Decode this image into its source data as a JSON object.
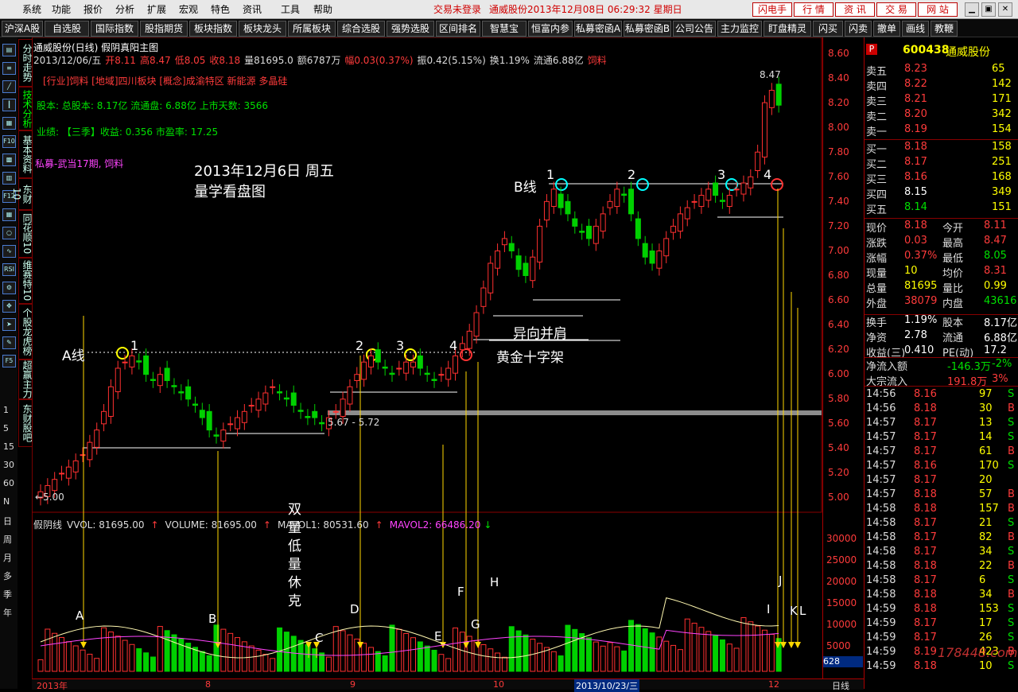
{
  "menu": [
    "系统",
    "功能",
    "报价",
    "分析",
    "扩展",
    "宏观",
    "特色",
    "资讯",
    "工具",
    "帮助"
  ],
  "status": {
    "trade_state": "交易未登录",
    "datetime": "通威股份2013年12月08日  06:29:32  星期日"
  },
  "top_buttons": [
    "闪电手",
    "行 情",
    "资 讯",
    "交 易",
    "网 站"
  ],
  "toolbar": [
    "沪深A股",
    "自选股",
    "国际指数",
    "股指期货",
    "板块指数",
    "板块龙头",
    "所属板块",
    "综合选股",
    "强势选股",
    "区间排名",
    "智慧宝",
    "恒富内参",
    "私募密函A",
    "私募密函B",
    "公司公告",
    "主力监控",
    "盯盘精灵",
    "闪买",
    "闪卖",
    "撤单",
    "画线",
    "教鞭"
  ],
  "left_strip": {
    "icons": [
      "chart-icon",
      "list-icon",
      "line-icon",
      "candle-icon",
      "table-icon",
      "F10",
      "grid-icon",
      "layers-icon",
      "F12",
      "table-icon",
      "search-icon",
      "wave-icon",
      "RSI",
      "gear-icon",
      "move-icon",
      "pointer-icon",
      "pen-icon",
      "F5"
    ],
    "periods": [
      "1",
      "5",
      "15",
      "30",
      "60",
      "N",
      "日",
      "周",
      "月",
      "多",
      "季",
      "年"
    ]
  },
  "vertical_tabs": [
    "分时走势",
    "技术分析",
    "基本资料",
    "东财10",
    "同花顺10",
    "维赛特10",
    "个股龙虎榜",
    "超赢主力",
    "东财股吧"
  ],
  "chart": {
    "title": "通威股份(日线) 假阴真阳主图",
    "ohlc_line": [
      "2013/12/06/五",
      "开8.11",
      "高8.47",
      "低8.05",
      "收8.18",
      "量81695.0",
      "额6787万",
      "幅0.03(0.37%)",
      "振0.42(5.15%)",
      "换1.19%",
      "流通6.88亿",
      "饲料"
    ],
    "industry": "[行业]饲料 [地域]四川板块 [概念]成渝特区 新能源 多晶硅",
    "equity": "股本: 总股本: 8.17亿 流通盘: 6.88亿 上市天数: 3566",
    "earnings": "业绩: 【三季】收益: 0.356 市盈率: 17.25",
    "private_fund": "私募-武当17期, 饲料",
    "heading_1": "2013年12月6日  周五",
    "heading_2": "量学看盘图",
    "low_marker": "←5.00",
    "high_marker": "8.47",
    "range_label": "5.67 - 5.72",
    "a_line": "A线",
    "b_line": "B线",
    "annot_1": "异向并肩",
    "annot_2": "黄金十字架",
    "vertical_note": [
      "双",
      "量",
      "低",
      "量",
      "休",
      "克"
    ],
    "volume_line": {
      "name": "假阴线",
      "vvol": "VVOL: 81695.00",
      "volume": "VOLUME: 81695.00",
      "mavol1": "MAVOL1: 80531.60",
      "mavol2": "MAVOL2: 66486.20"
    },
    "letters": [
      "A",
      "B",
      "C",
      "D",
      "E",
      "F",
      "G",
      "H",
      "I",
      "J",
      "K",
      "L"
    ],
    "numbers": [
      "1",
      "2",
      "3",
      "4"
    ]
  },
  "price_axis": [
    "8.60",
    "8.40",
    "8.20",
    "8.00",
    "7.80",
    "7.60",
    "7.40",
    "7.20",
    "7.00",
    "6.80",
    "6.60",
    "6.40",
    "6.20",
    "6.00",
    "5.80",
    "5.60",
    "5.40",
    "5.20",
    "5.00"
  ],
  "volume_axis": [
    "30000",
    "25000",
    "20000",
    "15000",
    "10000",
    "5000"
  ],
  "volume_axis_value": "628",
  "bottom_dates": [
    "2013年",
    "8",
    "9",
    "10",
    "2013/10/23/三",
    "12"
  ],
  "bottom_period": "日线",
  "quote": {
    "header_tag": "P",
    "code": "600438",
    "name": "通威股份",
    "sell": [
      [
        "卖五",
        "8.23",
        "65"
      ],
      [
        "卖四",
        "8.22",
        "142"
      ],
      [
        "卖三",
        "8.21",
        "171"
      ],
      [
        "卖二",
        "8.20",
        "342"
      ],
      [
        "卖一",
        "8.19",
        "154"
      ]
    ],
    "buy": [
      [
        "买一",
        "8.18",
        "158"
      ],
      [
        "买二",
        "8.17",
        "251"
      ],
      [
        "买三",
        "8.16",
        "168"
      ],
      [
        "买四",
        "8.15",
        "349"
      ],
      [
        "买五",
        "8.14",
        "151"
      ]
    ],
    "stats": [
      [
        "现价",
        "8.18",
        "今开",
        "8.11"
      ],
      [
        "涨跌",
        "0.03",
        "最高",
        "8.47"
      ],
      [
        "涨幅",
        "0.37%",
        "最低",
        "8.05"
      ],
      [
        "现量",
        "10",
        "均价",
        "8.31"
      ],
      [
        "总量",
        "81695",
        "量比",
        "0.99"
      ],
      [
        "外盘",
        "38079",
        "内盘",
        "43616"
      ],
      [
        "换手",
        "1.19%",
        "股本",
        "8.17亿"
      ],
      [
        "净资",
        "2.78",
        "流通",
        "6.88亿"
      ],
      [
        "收益(三)",
        "0.410",
        "PE(动)",
        "17.2"
      ]
    ],
    "flow": [
      [
        "净流入额",
        "-146.3万",
        "-2%"
      ],
      [
        "大宗流入",
        "191.8万",
        "3%"
      ]
    ],
    "ticks": [
      [
        "14:56",
        "8.16",
        "97",
        "S"
      ],
      [
        "14:56",
        "8.18",
        "30",
        "B"
      ],
      [
        "14:57",
        "8.17",
        "13",
        "S"
      ],
      [
        "14:57",
        "8.17",
        "14",
        "S"
      ],
      [
        "14:57",
        "8.17",
        "61",
        "B"
      ],
      [
        "14:57",
        "8.16",
        "170",
        "S"
      ],
      [
        "14:57",
        "8.17",
        "20",
        ""
      ],
      [
        "14:57",
        "8.18",
        "57",
        "B"
      ],
      [
        "14:58",
        "8.18",
        "157",
        "B"
      ],
      [
        "14:58",
        "8.17",
        "21",
        "S"
      ],
      [
        "14:58",
        "8.17",
        "82",
        "B"
      ],
      [
        "14:58",
        "8.17",
        "34",
        "S"
      ],
      [
        "14:58",
        "8.18",
        "22",
        "B"
      ],
      [
        "14:58",
        "8.17",
        "6",
        "S"
      ],
      [
        "14:58",
        "8.18",
        "34",
        "B"
      ],
      [
        "14:59",
        "8.18",
        "153",
        "S"
      ],
      [
        "14:59",
        "8.17",
        "17",
        "S"
      ],
      [
        "14:59",
        "8.17",
        "26",
        "S"
      ],
      [
        "14:59",
        "8.19",
        "423",
        "B"
      ],
      [
        "14:59",
        "8.18",
        "10",
        "S"
      ]
    ],
    "watermark": "178448.com"
  }
}
